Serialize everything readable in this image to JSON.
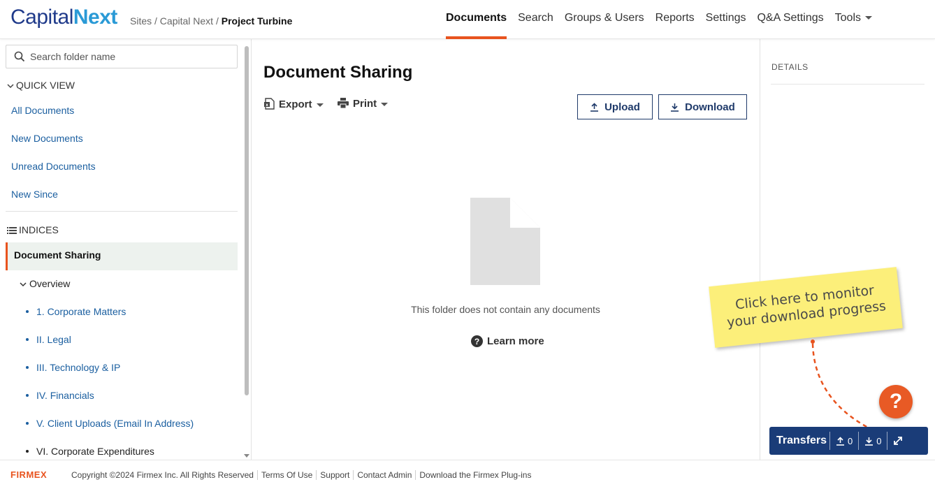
{
  "header": {
    "logo_part1": "Capital",
    "logo_part2": "Next",
    "breadcrumb": {
      "sites": "Sites",
      "sep1": "/",
      "site": "Capital Next",
      "sep2": "/",
      "project": "Project Turbine"
    },
    "nav": [
      "Documents",
      "Search",
      "Groups & Users",
      "Reports",
      "Settings",
      "Q&A Settings",
      "Tools"
    ],
    "active_nav": "Documents"
  },
  "sidebar": {
    "search_placeholder": "Search folder name",
    "quick_view_label": "QUICK VIEW",
    "quick_view_items": [
      "All Documents",
      "New Documents",
      "Unread Documents",
      "New Since"
    ],
    "indices_label": "INDICES",
    "selected_index": "Document Sharing",
    "overview_label": "Overview",
    "folders": [
      "1. Corporate Matters",
      "II. Legal",
      "III. Technology & IP",
      "IV. Financials",
      "V. Client Uploads (Email In Address)",
      "VI. Corporate Expenditures"
    ]
  },
  "main": {
    "title": "Document Sharing",
    "export_label": "Export",
    "print_label": "Print",
    "upload_label": "Upload",
    "download_label": "Download",
    "empty_message": "This folder does not contain any documents",
    "learn_more_label": "Learn more"
  },
  "details": {
    "label": "DETAILS"
  },
  "note": {
    "line1": "Click here to monitor",
    "line2": "your download progress"
  },
  "help": {
    "symbol": "?"
  },
  "transfers": {
    "label": "Transfers",
    "uploads": "0",
    "downloads": "0"
  },
  "footer": {
    "brand": "FIRMEX",
    "copyright": "Copyright ©2024 Firmex Inc. All Rights Reserved",
    "links": [
      "Terms Of Use",
      "Support",
      "Contact Admin",
      "Download the Firmex Plug-ins"
    ]
  },
  "colors": {
    "accent": "#e8531e",
    "navy": "#1a3c78",
    "link": "#1b5fa0",
    "note": "#fcef7a"
  }
}
